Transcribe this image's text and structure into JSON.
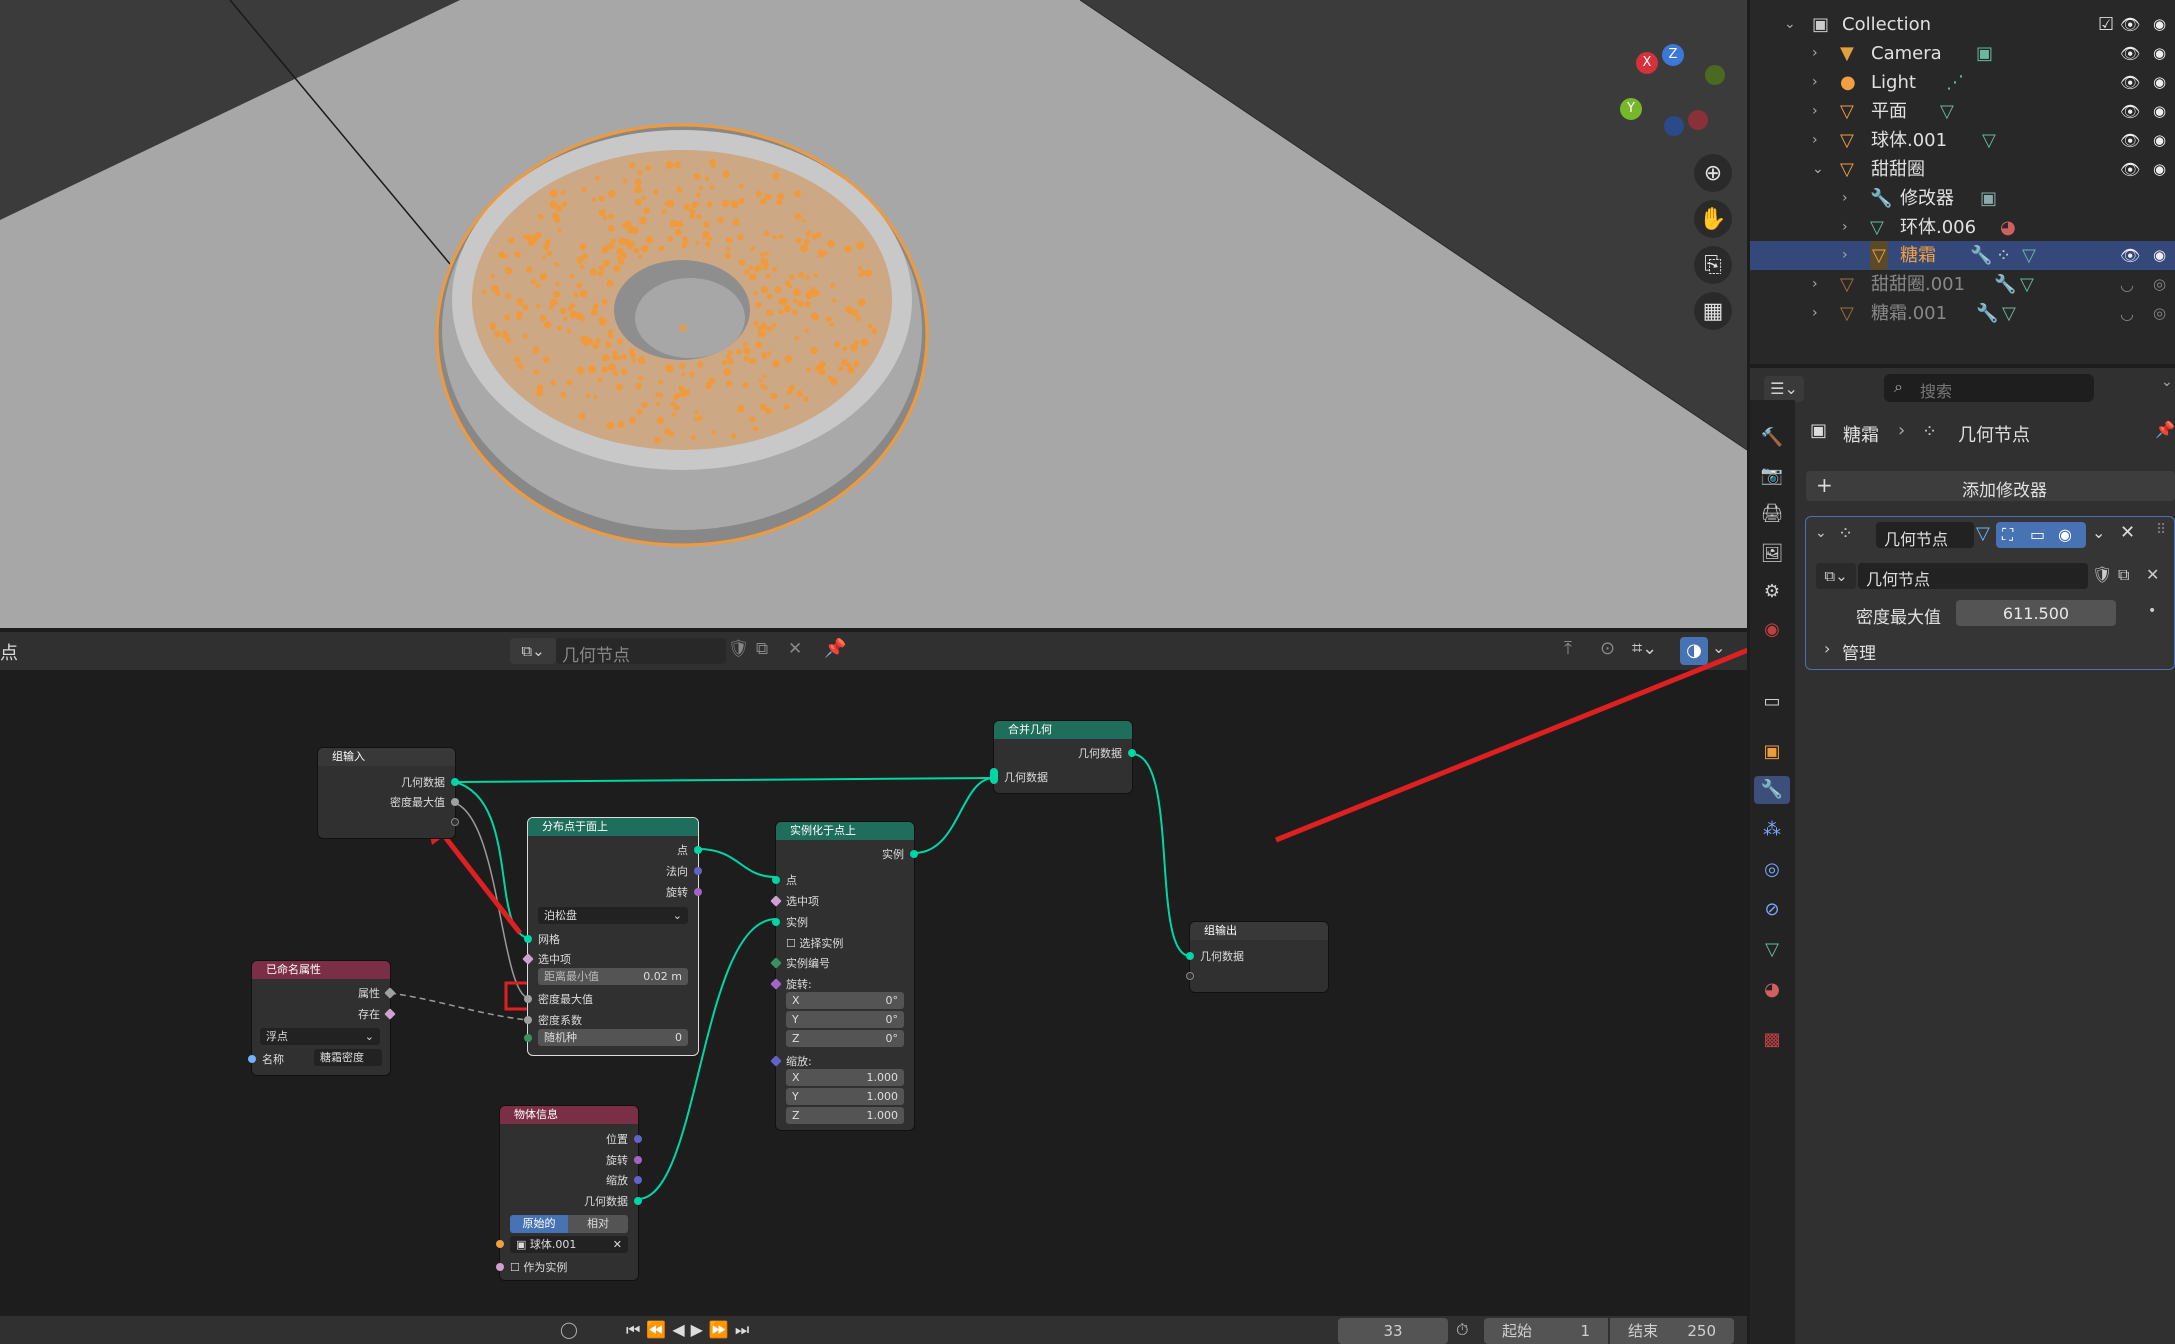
{
  "viewport": {
    "gizmo": {
      "x": "X",
      "y": "Y",
      "z": "Z"
    },
    "tool_icons": [
      "zoom-icon",
      "hand-icon",
      "camera-icon",
      "grid-icon"
    ]
  },
  "outliner": {
    "rows": [
      {
        "label": "Collection",
        "indent": 0,
        "icon": "collection-icon"
      },
      {
        "label": "Camera",
        "indent": 1,
        "icon": "camera-icon"
      },
      {
        "label": "Light",
        "indent": 1,
        "icon": "light-icon"
      },
      {
        "label": "平面",
        "indent": 1,
        "icon": "mesh-icon"
      },
      {
        "label": "球体.001",
        "indent": 1,
        "icon": "mesh-icon"
      },
      {
        "label": "甜甜圈",
        "indent": 1,
        "icon": "mesh-icon"
      },
      {
        "label": "修改器",
        "indent": 2,
        "icon": "wrench-icon"
      },
      {
        "label": "环体.006",
        "indent": 2,
        "icon": "mesh-data-icon"
      },
      {
        "label": "糖霜",
        "indent": 2,
        "icon": "mesh-icon",
        "selected": true
      },
      {
        "label": "甜甜圈.001",
        "indent": 1,
        "icon": "mesh-icon",
        "dim": true
      },
      {
        "label": "糖霜.001",
        "indent": 1,
        "icon": "mesh-icon",
        "dim": true
      }
    ]
  },
  "properties": {
    "search_placeholder": "搜索",
    "breadcrumb_object": "糖霜",
    "breadcrumb_modifier": "几何节点",
    "add_modifier": "添加修改器",
    "modifier_name": "几何节点",
    "node_group": "几何节点",
    "density_label": "密度最大值",
    "density_value": "611.500",
    "manage": "管理"
  },
  "node_editor": {
    "header_name": "几何节点",
    "left_label": "点",
    "group_input": {
      "title": "组输入",
      "out_geometry": "几何数据",
      "out_density": "密度最大值"
    },
    "distribute": {
      "title": "分布点于面上",
      "points": "点",
      "normal": "法向",
      "rotation": "旋转",
      "mode": "泊松盘",
      "mesh": "网格",
      "selection": "选中项",
      "min_dist_label": "距离最小值",
      "min_dist_value": "0.02 m",
      "density_max": "密度最大值",
      "density_factor": "密度系数",
      "seed_label": "随机种",
      "seed_value": "0"
    },
    "named_attr": {
      "title": "已命名属性",
      "attribute": "属性",
      "exists": "存在",
      "type": "浮点",
      "name_label": "名称",
      "name_value": "糖霜密度"
    },
    "instance": {
      "title": "实例化于点上",
      "out_instances": "实例",
      "points": "点",
      "selection": "选中项",
      "instance": "实例",
      "pick": "选择实例",
      "index": "实例编号",
      "rotation": "旋转:",
      "rx": "0°",
      "ry": "0°",
      "rz": "0°",
      "scale": "缩放:",
      "sx": "1.000",
      "sy": "1.000",
      "sz": "1.000",
      "X": "X",
      "Y": "Y",
      "Z": "Z"
    },
    "join": {
      "title": "合并几何",
      "out": "几何数据",
      "in": "几何数据"
    },
    "group_output": {
      "title": "组输出",
      "in": "几何数据"
    },
    "object_info": {
      "title": "物体信息",
      "location": "位置",
      "rotation": "旋转",
      "scale": "缩放",
      "geometry": "几何数据",
      "original": "原始的",
      "relative": "相对",
      "object": "球体.001",
      "as_instance": "作为实例"
    }
  },
  "timeline": {
    "frame": "33",
    "start_label": "起始",
    "start": "1",
    "end_label": "结束",
    "end": "250"
  },
  "colors": {
    "accent": "#4772b3",
    "selection": "#f09a3c",
    "geometry_socket": "#00d6a3",
    "annotation": "#e02020",
    "input_header": "#7a2f47",
    "geo_header": "#1f6e5c"
  }
}
